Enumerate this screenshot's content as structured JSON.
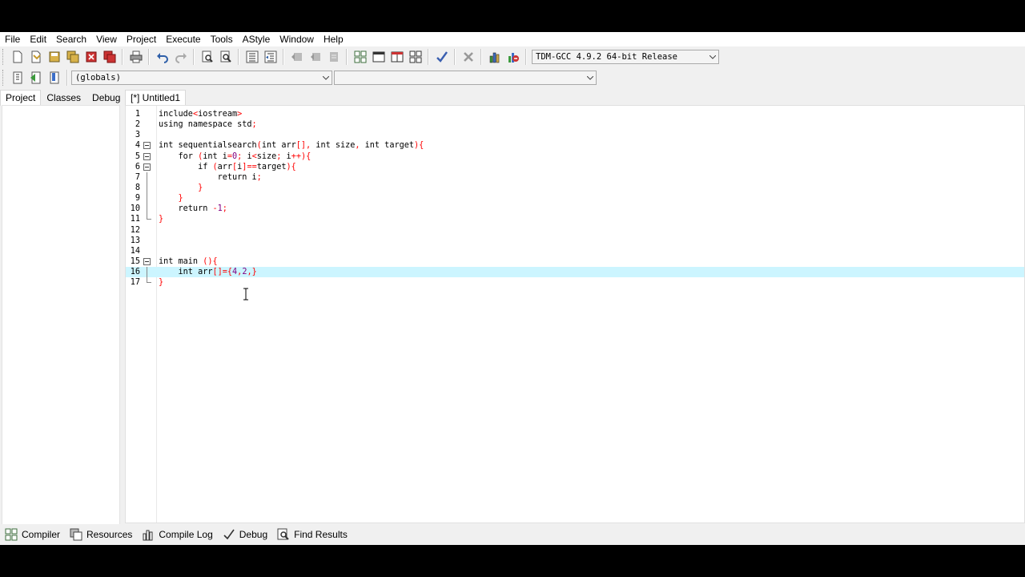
{
  "menu": [
    "File",
    "Edit",
    "Search",
    "View",
    "Project",
    "Execute",
    "Tools",
    "AStyle",
    "Window",
    "Help"
  ],
  "toolbar": {
    "compiler_select": "TDM-GCC 4.9.2 64-bit Release",
    "scope_select": "(globals)",
    "symbol_select": ""
  },
  "left_tabs": [
    "Project",
    "Classes",
    "Debug"
  ],
  "editor_tab": "[*] Untitled1",
  "code": {
    "lines": [
      {
        "n": "1",
        "text": "include<iostream>"
      },
      {
        "n": "2",
        "text": "using namespace std;"
      },
      {
        "n": "3",
        "text": ""
      },
      {
        "n": "4",
        "text": "int sequentialsearch(int arr[], int size, int target){"
      },
      {
        "n": "5",
        "text": "    for (int i=0; i<size; i++){"
      },
      {
        "n": "6",
        "text": "        if (arr[i]==target){"
      },
      {
        "n": "7",
        "text": "            return i;"
      },
      {
        "n": "8",
        "text": "        }"
      },
      {
        "n": "9",
        "text": "    }"
      },
      {
        "n": "10",
        "text": "    return -1;"
      },
      {
        "n": "11",
        "text": "}"
      },
      {
        "n": "12",
        "text": ""
      },
      {
        "n": "13",
        "text": ""
      },
      {
        "n": "14",
        "text": ""
      },
      {
        "n": "15",
        "text": "int main (){"
      },
      {
        "n": "16",
        "text": "    int arr[]={4,2,}"
      },
      {
        "n": "17",
        "text": "}"
      }
    ]
  },
  "bottom_tabs": [
    {
      "label": "Compiler",
      "icon": "compiler-icon"
    },
    {
      "label": "Resources",
      "icon": "resources-icon"
    },
    {
      "label": "Compile Log",
      "icon": "compile-log-icon"
    },
    {
      "label": "Debug",
      "icon": "debug-icon"
    },
    {
      "label": "Find Results",
      "icon": "find-results-icon"
    }
  ],
  "colors": {
    "current_line": "#ccf5ff",
    "symbol": "#ff0000",
    "number": "#800080",
    "bracket_match": "#ff2020"
  }
}
